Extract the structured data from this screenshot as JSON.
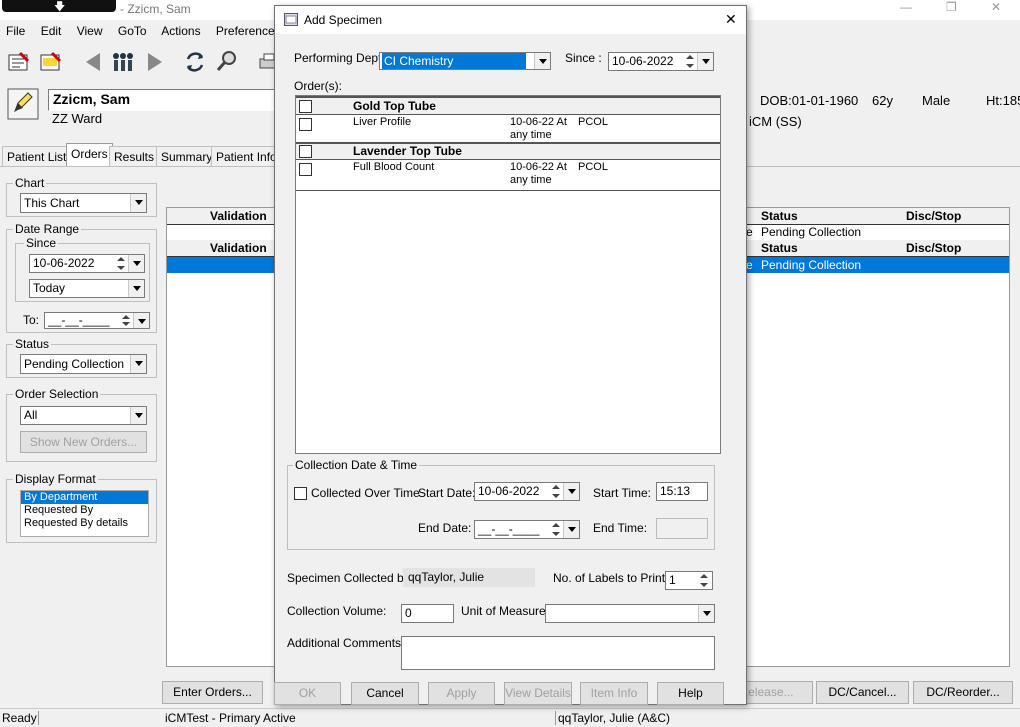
{
  "app": {
    "title": "- Zzicm, Sam",
    "window_controls": {
      "minimize": "—",
      "restore": "❐",
      "close": "✕"
    },
    "menu": [
      "File",
      "Edit",
      "View",
      "GoTo",
      "Actions",
      "Preferences"
    ]
  },
  "patient": {
    "name": "Zzicm, Sam",
    "ward": "ZZ Ward",
    "dob": "DOB:01-01-1960",
    "age": "62y",
    "sex": "Male",
    "height": "Ht:185",
    "team": "iCM (SS)"
  },
  "tabs": [
    "Patient List",
    "Orders",
    "Results",
    "Summary",
    "Patient Info"
  ],
  "left_panel": {
    "chart_label": "Chart",
    "chart_value": "This Chart",
    "date_range_label": "Date Range",
    "since_label": "Since",
    "since_value": "10-06-2022",
    "since_preset": "Today",
    "to_label": "To:",
    "to_value": "__-__-____",
    "status_label": "Status",
    "status_value": "Pending Collection",
    "order_selection_label": "Order Selection",
    "order_selection_value": "All",
    "show_new_orders": "Show New Orders...",
    "display_format_label": "Display Format",
    "display_formats": [
      "By Department",
      "Requested By",
      "Requested By details"
    ]
  },
  "orders_table": {
    "columns": {
      "validation": "Validation",
      "status": "Status",
      "disc_stop": "Disc/Stop"
    },
    "rows": [
      {
        "status": "Pending Collection",
        "prefix": "e"
      },
      {
        "status": "Pending Collection",
        "prefix": "e"
      }
    ]
  },
  "bottom_buttons": {
    "enter_orders": "Enter Orders...",
    "release": "Release...",
    "dc_cancel": "DC/Cancel...",
    "dc_reorder": "DC/Reorder..."
  },
  "status_bar": {
    "ready": "Ready",
    "system": "iCMTest - Primary Active",
    "user": "qqTaylor, Julie  (A&C)"
  },
  "dialog": {
    "title": "Add Specimen",
    "close": "✕",
    "performing_dept_label": "Performing Dept.",
    "performing_dept_value": "CI Chemistry",
    "since_label": "Since :",
    "since_value": "10-06-2022",
    "orders_label": "Order(s):",
    "orders": [
      {
        "kind": "group",
        "name": "Gold Top Tube"
      },
      {
        "kind": "item",
        "name": "Liver Profile",
        "when": "10-06-22 At",
        "when2": "any time",
        "code": "PCOL"
      },
      {
        "kind": "group",
        "name": "Lavender Top Tube"
      },
      {
        "kind": "item",
        "name": "Full Blood Count",
        "when": "10-06-22 At",
        "when2": "any time",
        "code": "PCOL"
      }
    ],
    "collection": {
      "group_label": "Collection Date & Time",
      "collected_over_time": "Collected Over Time",
      "start_date_label": "Start Date:",
      "start_date": "10-06-2022",
      "start_time_label": "Start Time:",
      "start_time": "15:13",
      "end_date_label": "End Date:",
      "end_date": "__-__-____",
      "end_time_label": "End Time:"
    },
    "collected_by_label": "Specimen Collected by:",
    "collected_by": "qqTaylor, Julie",
    "labels_label": "No. of Labels to Print:",
    "labels": "1",
    "volume_label": "Collection Volume:",
    "volume": "0",
    "unit_label": "Unit of Measure:",
    "unit": "",
    "comments_label": "Additional Comments:",
    "buttons": {
      "ok": "OK",
      "cancel": "Cancel",
      "apply": "Apply",
      "view_details": "View Details",
      "item_info": "Item Info",
      "help": "Help"
    }
  },
  "colors": {
    "selection": "#0078d7",
    "dialog_bg": "#f0f0f0",
    "window_bg": "#f0f0f0"
  }
}
